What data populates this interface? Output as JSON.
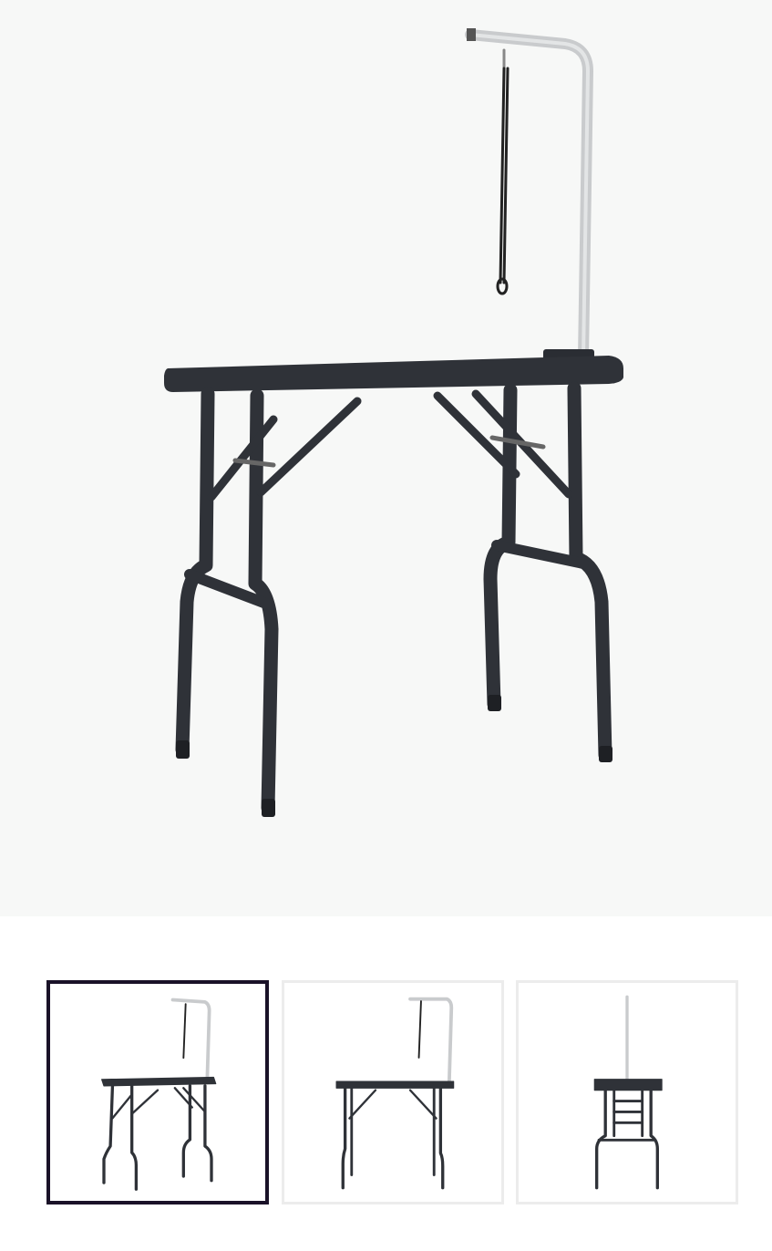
{
  "gallery": {
    "main_image": {
      "icon": "grooming-table-front-angle-image"
    },
    "selected_index": 0,
    "thumbnails": [
      {
        "icon": "grooming-table-angle-thumbnail"
      },
      {
        "icon": "grooming-table-side-thumbnail"
      },
      {
        "icon": "grooming-table-end-thumbnail"
      }
    ]
  },
  "colors": {
    "background": "#f7f8f7",
    "table": "#2f3238",
    "arm": "#c9cbcd",
    "selected_border": "#1a1228",
    "thumb_border": "#ececec"
  }
}
